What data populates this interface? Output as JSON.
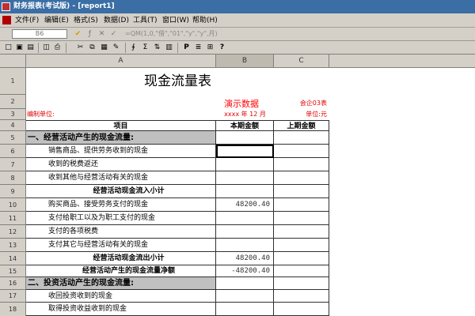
{
  "window": {
    "title": "财务报表(考试版) - [report1]"
  },
  "menu": [
    "文件(F)",
    "编辑(E)",
    "格式(S)",
    "数据(D)",
    "工具(T)",
    "窗口(W)",
    "帮助(H)"
  ],
  "editbar": {
    "cell_ref": "B6",
    "formula_text": "=QM(1,0,\"借\",\"01\",\"y\",\"y\",月)"
  },
  "toolbar": {
    "icons": [
      "new-icon",
      "open-icon",
      "save-icon",
      "print-preview-icon",
      "print-icon",
      "cut-icon",
      "copy-icon",
      "paste-icon",
      "format-painter-icon",
      "function-icon",
      "sum-icon",
      "sort-icon",
      "chart-icon",
      "bold-p-icon",
      "fill-icon",
      "align-icon",
      "help-icon"
    ],
    "glyphs": [
      "□",
      "▣",
      "▤",
      "◫",
      "⎙",
      "✂",
      "⧉",
      "▦",
      "✎",
      "∮",
      "Σ",
      "⇅",
      "▥",
      "P",
      "≣",
      "⊞",
      "?"
    ]
  },
  "columns": [
    "A",
    "B",
    "C"
  ],
  "rows": [
    {
      "num": "1",
      "a": "现金流量表",
      "b": "",
      "c": ""
    },
    {
      "num": "2",
      "a": "",
      "b": "",
      "c": "会企03表"
    },
    {
      "num": "3",
      "a": "编制单位:",
      "b": "xxxx 年 12 月",
      "c": "单位:元"
    },
    {
      "num": "4",
      "a": "项目",
      "b": "本期金额",
      "c": "上期金额"
    },
    {
      "num": "5",
      "a": "一、经营活动产生的现金流量:",
      "b": "",
      "c": ""
    },
    {
      "num": "6",
      "a": "销售商品、提供劳务收到的现金",
      "b": "",
      "c": ""
    },
    {
      "num": "7",
      "a": "收到的税费返还",
      "b": "",
      "c": ""
    },
    {
      "num": "8",
      "a": "收到其他与经营活动有关的现金",
      "b": "",
      "c": ""
    },
    {
      "num": "9",
      "a": "经营活动现金流入小计",
      "b": "",
      "c": ""
    },
    {
      "num": "10",
      "a": "购买商品、接受劳务支付的现金",
      "b": "48200.40",
      "c": ""
    },
    {
      "num": "11",
      "a": "支付给职工以及为职工支付的现金",
      "b": "",
      "c": ""
    },
    {
      "num": "12",
      "a": "支付的各项税费",
      "b": "",
      "c": ""
    },
    {
      "num": "13",
      "a": "支付其它与经营活动有关的现金",
      "b": "",
      "c": ""
    },
    {
      "num": "14",
      "a": "经营活动现金流出小计",
      "b": "48200.40",
      "c": ""
    },
    {
      "num": "15",
      "a": "经营活动产生的现金流量净额",
      "b": "-48200.40",
      "c": ""
    },
    {
      "num": "16",
      "a": "二、投资活动产生的现金流量:",
      "b": "",
      "c": ""
    },
    {
      "num": "17",
      "a": "收回投资收到的现金",
      "b": "",
      "c": ""
    },
    {
      "num": "18",
      "a": "取得投资收益收到的现金",
      "b": "",
      "c": ""
    }
  ],
  "overlay_text": "演示数据",
  "colors": {
    "title_bar": "#3a6ea5",
    "red_text": "#e00000",
    "grid": "#303030",
    "section_fill": "#c0c0c0"
  }
}
